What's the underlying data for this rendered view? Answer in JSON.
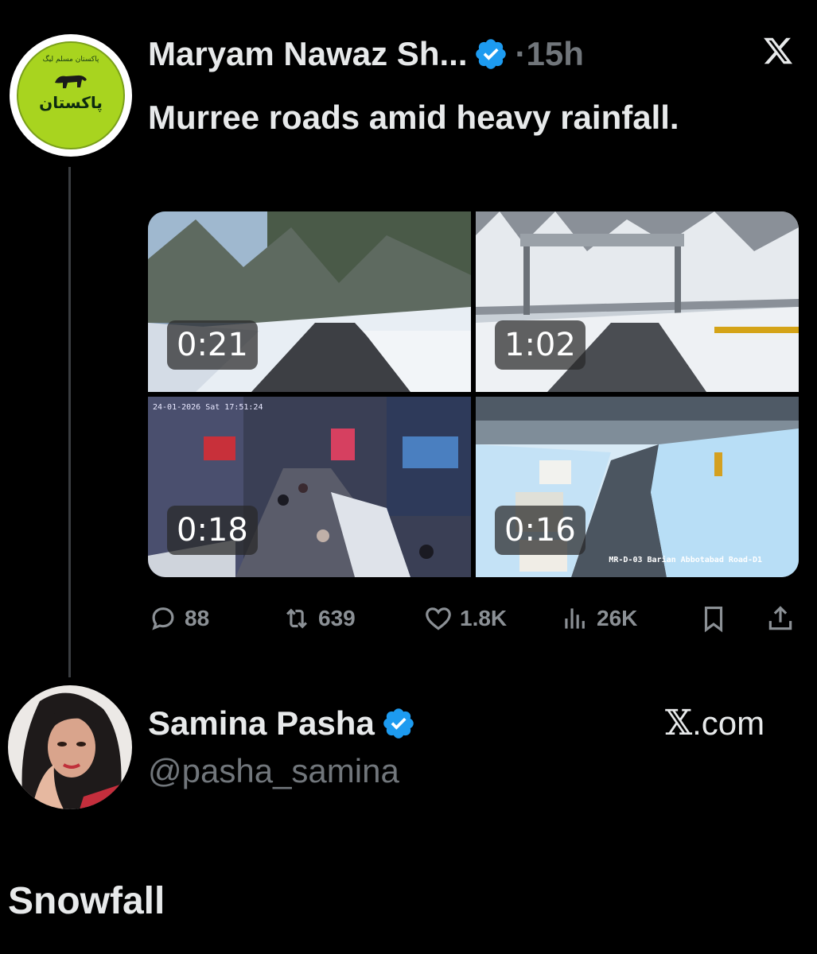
{
  "tweet1": {
    "display_name": "Maryam Nawaz Sh...",
    "time": "15h",
    "text": "Murree roads amid heavy rainfall.",
    "avatar_text": "پاکستان",
    "avatar_top_text": "پاکستان مسلم لیگ",
    "videos": [
      {
        "duration": "0:21",
        "scene": "snowy-road-trees"
      },
      {
        "duration": "1:02",
        "scene": "snowy-road-gate"
      },
      {
        "duration": "0:18",
        "scene": "street-pedestrians"
      },
      {
        "duration": "0:16",
        "scene": "road-cctv-vehicles",
        "caption": "MR-D-03 Barian Abbotabad Road-D1"
      }
    ],
    "video3_stamp": "24-01-2026 Sat 17:51:24",
    "actions": {
      "replies": "88",
      "reposts": "639",
      "likes": "1.8K",
      "views": "26K"
    }
  },
  "tweet2": {
    "display_name": "Samina Pasha",
    "handle": "@pasha_samina",
    "site_x": "𝕏",
    "site_domain": ".com",
    "text": "Snowfall"
  },
  "colors": {
    "background": "#000000",
    "text": "#e7e9ea",
    "secondary": "#71767b",
    "verified": "#1d9bf0",
    "thread_line": "#3a3d41"
  },
  "icons": [
    "verified-badge-icon",
    "x-logo-icon",
    "reply-icon",
    "repost-icon",
    "like-icon",
    "views-icon",
    "bookmark-icon",
    "share-icon"
  ]
}
